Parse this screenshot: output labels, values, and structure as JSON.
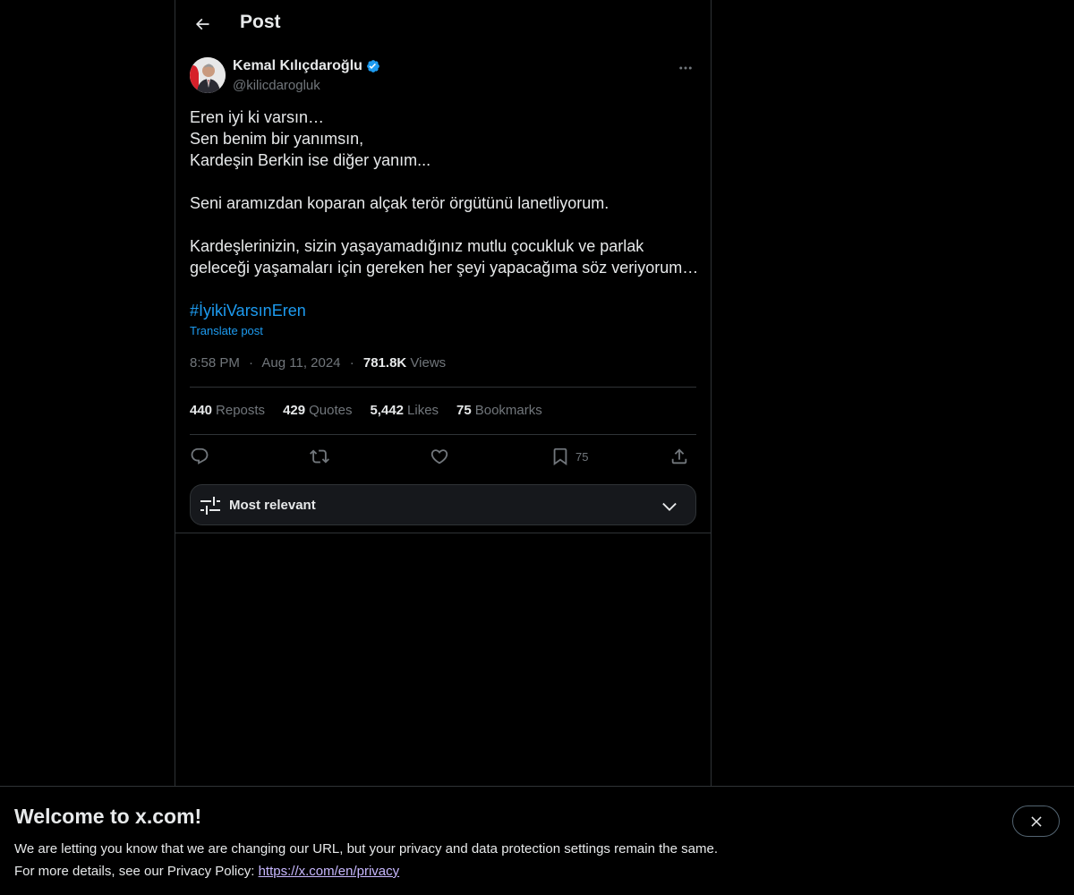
{
  "header": {
    "title": "Post",
    "back_icon": "arrow-left-icon"
  },
  "author": {
    "name": "Kemal Kılıçdaroğlu",
    "handle": "@kilicdarogluk",
    "verified": true,
    "verified_color": "#1d9bf0"
  },
  "post": {
    "lines": [
      "Eren iyi ki varsın…",
      "Sen benim bir yanımsın,",
      "Kardeşin Berkin ise diğer yanım...",
      "",
      "Seni aramızdan koparan alçak terör örgütünü lanetliyorum.",
      "",
      "Kardeşlerinizin, sizin yaşayamadığınız mutlu çocukluk ve parlak",
      "geleceği yaşamaları için gereken her şeyi yapacağıma söz veriyorum…"
    ],
    "hashtag": "#İyikiVarsınEren",
    "translate_label": "Translate post",
    "time": "8:58 PM",
    "separator": "·",
    "date": "Aug 11, 2024",
    "views_count": "781.8K",
    "views_label": "Views"
  },
  "stats": [
    {
      "count": "440",
      "label": "Reposts"
    },
    {
      "count": "429",
      "label": "Quotes"
    },
    {
      "count": "5,442",
      "label": "Likes"
    },
    {
      "count": "75",
      "label": "Bookmarks"
    }
  ],
  "actions": {
    "reply_icon": "reply-icon",
    "repost_icon": "repost-icon",
    "like_icon": "heart-icon",
    "bookmark_icon": "bookmark-icon",
    "bookmark_count": "75",
    "share_icon": "share-icon"
  },
  "replies_sort": {
    "label": "Most relevant"
  },
  "banner": {
    "title": "Welcome to x.com!",
    "line1": "We are letting you know that we are changing our URL, but your privacy and data protection settings remain the same.",
    "line2_prefix": "For more details, see our Privacy Policy: ",
    "link": "https://x.com/en/privacy"
  },
  "colors": {
    "background": "#000000",
    "text": "#e7e9ea",
    "muted": "#71767b",
    "accent": "#1d9bf0",
    "border": "#2f3336"
  }
}
